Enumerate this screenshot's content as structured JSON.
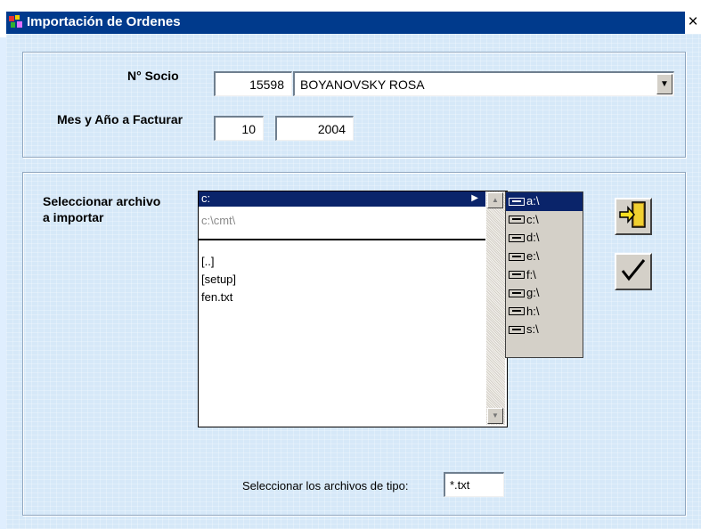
{
  "window": {
    "title": "Importación de Ordenes",
    "close_glyph": "×"
  },
  "socio": {
    "label": "N° Socio",
    "number": "15598",
    "name": "BOYANOVSKY ROSA"
  },
  "periodo": {
    "label": "Mes y Año a Facturar",
    "month": "10",
    "year": "2004"
  },
  "file_select": {
    "label_line1": "Seleccionar archivo",
    "label_line2": "a importar",
    "current_dir": "c:",
    "path_history": "c:\\cmt\\",
    "entries": [
      "[..]",
      "[setup]",
      "fen.txt"
    ]
  },
  "drives": [
    "a:\\",
    "c:\\",
    "d:\\",
    "e:\\",
    "f:\\",
    "g:\\",
    "h:\\",
    "s:\\"
  ],
  "selected_drive": "a:\\",
  "filter": {
    "label": "Seleccionar los archivos de tipo:",
    "value": "*.txt"
  },
  "buttons": {
    "exit_icon": "door-exit-icon",
    "accept_icon": "checkmark-icon"
  },
  "colors": {
    "titlebar": "#003a8c",
    "selection": "#0a246a",
    "background": "#d6e8f8"
  }
}
